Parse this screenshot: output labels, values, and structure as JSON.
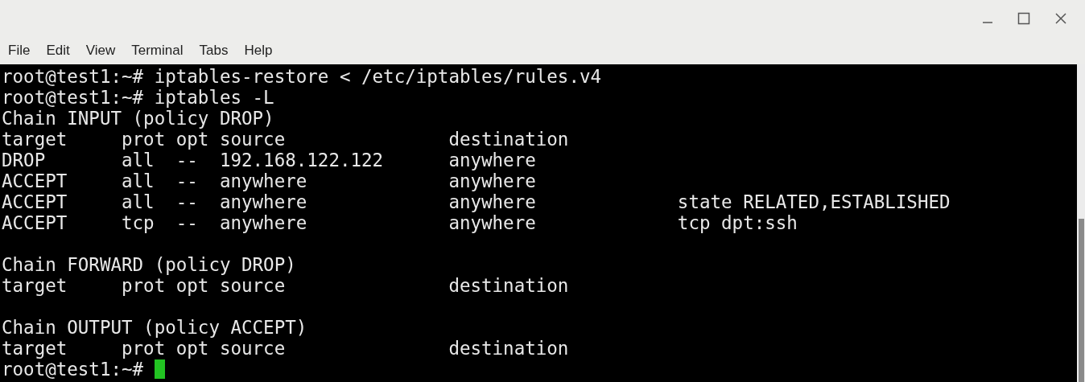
{
  "menu": [
    "File",
    "Edit",
    "View",
    "Terminal",
    "Tabs",
    "Help"
  ],
  "terminal": {
    "lines": [
      {
        "kind": "text",
        "text": "root@test1:~# iptables-restore < /etc/iptables/rules.v4"
      },
      {
        "kind": "text",
        "text": "root@test1:~# iptables -L"
      },
      {
        "kind": "text",
        "text": "Chain INPUT (policy DROP)"
      },
      {
        "kind": "text",
        "text": "target     prot opt source               destination"
      },
      {
        "kind": "text",
        "text": "DROP       all  --  192.168.122.122      anywhere"
      },
      {
        "kind": "text",
        "text": "ACCEPT     all  --  anywhere             anywhere"
      },
      {
        "kind": "text",
        "text": "ACCEPT     all  --  anywhere             anywhere             state RELATED,ESTABLISHED"
      },
      {
        "kind": "text",
        "text": "ACCEPT     tcp  --  anywhere             anywhere             tcp dpt:ssh"
      },
      {
        "kind": "blank"
      },
      {
        "kind": "text",
        "text": "Chain FORWARD (policy DROP)"
      },
      {
        "kind": "text",
        "text": "target     prot opt source               destination"
      },
      {
        "kind": "blank"
      },
      {
        "kind": "text",
        "text": "Chain OUTPUT (policy ACCEPT)"
      },
      {
        "kind": "text",
        "text": "target     prot opt source               destination"
      },
      {
        "kind": "text",
        "text": "root@test1:~# ",
        "cursor": true
      }
    ]
  }
}
